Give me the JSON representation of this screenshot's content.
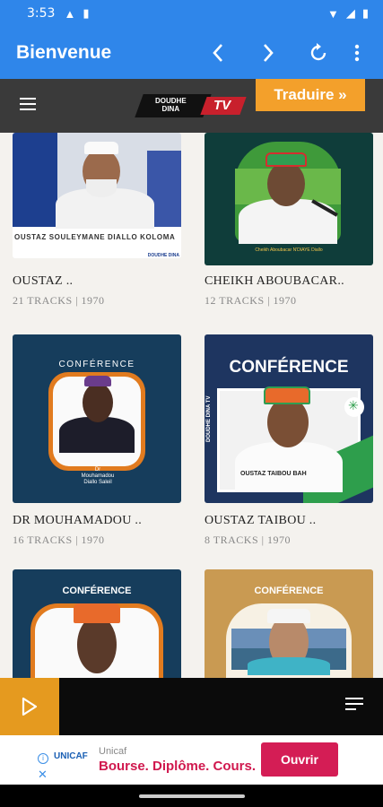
{
  "status_bar": {
    "time": "3:53"
  },
  "app_bar": {
    "title": "Bienvenue",
    "back_icon": "chevron-left",
    "forward_icon": "chevron-right",
    "refresh_icon": "refresh",
    "menu_icon": "more-vertical"
  },
  "site_header": {
    "logo_line1": "DOUDHE",
    "logo_line2": "DINA",
    "logo_tv": "TV",
    "translate_label": "Traduire »"
  },
  "cards": [
    {
      "name": "OUSTAZ ..",
      "meta": "21 TRACKS | 1970",
      "thumb_caption": "OUSTAZ  SOULEYMANE DIALLO KOLOMA",
      "thumb_tag": "DOUDHE DINA"
    },
    {
      "name": "CHEIKH ABOUBACAR..",
      "meta": "12 TRACKS | 1970",
      "thumb_caption": "Cheikh Aboubacar N'DIAYE Diallo"
    },
    {
      "name": "DR MOUHAMADOU ..",
      "meta": "16 TRACKS | 1970",
      "thumb_title": "CONFÉRENCE",
      "thumb_caption": "Dr Mouhamadou Diallo Saleil"
    },
    {
      "name": "OUSTAZ TAIBOU ..",
      "meta": "8 TRACKS | 1970",
      "thumb_title": "CONFÉRENCE",
      "thumb_caption": "OUSTAZ TAIBOU BAH",
      "thumb_side": "DOUDHE DINA TV"
    },
    {
      "name": "",
      "meta": "",
      "thumb_title": "CONFÉRENCE"
    },
    {
      "name": "",
      "meta": "",
      "thumb_title": "CONFÉRENCE"
    }
  ],
  "ad": {
    "advertiser": "Unicaf",
    "headline": "Bourse. Diplôme. Cours.",
    "cta": "Ouvrir",
    "logo_text": "UNICAF"
  },
  "colors": {
    "app_bar": "#2f86ea",
    "header": "#3a3a3a",
    "translate": "#f3a02b",
    "player_accent": "#e59a1f",
    "ad_cta": "#d41d55"
  }
}
